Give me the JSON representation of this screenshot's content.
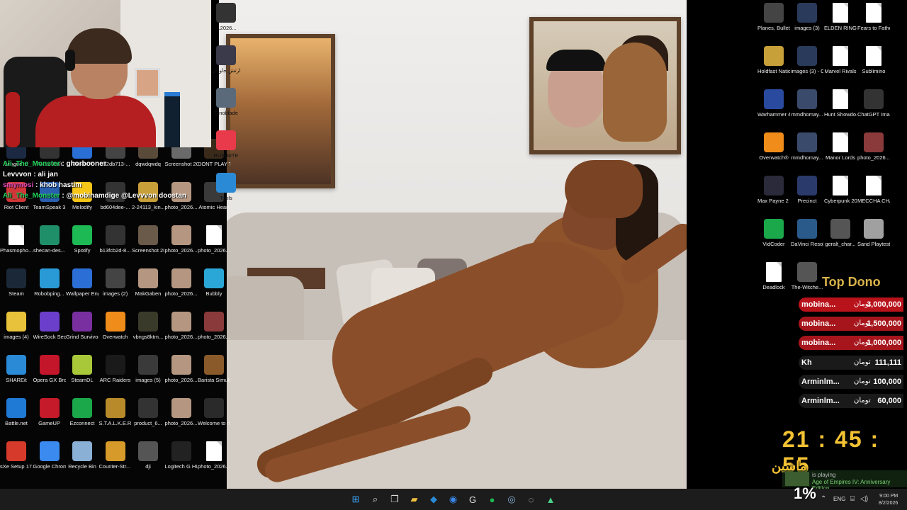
{
  "left_icons": [
    {
      "label": "League of",
      "color": "#1b2a42"
    },
    {
      "label": "PacketRaft",
      "color": "#333333"
    },
    {
      "label": "Microsoft",
      "color": "#2a6fd6"
    },
    {
      "label": "b52db713-...",
      "color": "#444"
    },
    {
      "label": "dqwdqwdq",
      "color": "#5a4a3a"
    },
    {
      "label": "Screenshot 2026-06-...",
      "color": "#6a6a6a"
    },
    {
      "label": "DONT PLAY THIS",
      "color": "#3a2a1a"
    },
    {
      "label": "Riot Client",
      "color": "#d13639"
    },
    {
      "label": "TeamSpeak 3 Client",
      "color": "#2a5fb0"
    },
    {
      "label": "Melodify",
      "color": "#f5c518"
    },
    {
      "label": "bd604dee-...",
      "color": "#333"
    },
    {
      "label": "2-24113_kin...",
      "color": "#c8a03a"
    },
    {
      "label": "photo_2026...",
      "color": "#b59680"
    },
    {
      "label": "Atomic Heart",
      "color": "#3a3a3a"
    },
    {
      "label": "Phasmopho...",
      "color": "#ffffff",
      "doc": true
    },
    {
      "label": "shecan-des...",
      "color": "#1f8f6a"
    },
    {
      "label": "Spotify",
      "color": "#1db954"
    },
    {
      "label": "b13fcb2d-8...",
      "color": "#333"
    },
    {
      "label": "Screenshot 2026-06-...",
      "color": "#6a5a4a"
    },
    {
      "label": "photo_2026...",
      "color": "#b59680"
    },
    {
      "label": "photo_2026...",
      "color": "#ffffff",
      "doc": true
    },
    {
      "label": "Steam",
      "color": "#1b2838"
    },
    {
      "label": "Robobping...",
      "color": "#2a9ad6"
    },
    {
      "label": "Wallpaper Engine",
      "color": "#2b6fd6"
    },
    {
      "label": "images (2)",
      "color": "#444"
    },
    {
      "label": "MakGaben",
      "color": "#b59680"
    },
    {
      "label": "photo_2026...",
      "color": "#b59680"
    },
    {
      "label": "Bubbly",
      "color": "#2aa7d6"
    },
    {
      "label": "images (4)",
      "color": "#e8c23a"
    },
    {
      "label": "WireSock Secure ...",
      "color": "#6b3fc9"
    },
    {
      "label": "Grind Survivors",
      "color": "#7a2fa0"
    },
    {
      "label": "Overwatch",
      "color": "#f08c1a"
    },
    {
      "label": "vbngs8ktm...",
      "color": "#3a3a2a"
    },
    {
      "label": "photo_2026...",
      "color": "#b59680"
    },
    {
      "label": "photo_2026...",
      "color": "#8a3a3a"
    },
    {
      "label": "SHAREit",
      "color": "#2a8ad6"
    },
    {
      "label": "Opera GX Browser",
      "color": "#c4162a"
    },
    {
      "label": "SteamDL",
      "color": "#a8c83a"
    },
    {
      "label": "ARC Raiders",
      "color": "#1a1a1a"
    },
    {
      "label": "images (5)",
      "color": "#3a3a3a"
    },
    {
      "label": "photo_2026...",
      "color": "#b59680"
    },
    {
      "label": "Barista Simulator",
      "color": "#8a5a2a"
    },
    {
      "label": "Battle.net",
      "color": "#1f7ad6"
    },
    {
      "label": "GameUP",
      "color": "#c41a2a"
    },
    {
      "label": "Ezconnect",
      "color": "#1aa84a"
    },
    {
      "label": "S.T.A.L.K.E.R. 2 Heart of ...",
      "color": "#b88a2a"
    },
    {
      "label": "product_6...",
      "color": "#333"
    },
    {
      "label": "photo_2026...",
      "color": "#b59680"
    },
    {
      "label": "Welcome to the Game...",
      "color": "#2a2a2a"
    },
    {
      "label": "sXe Setup 17.2",
      "color": "#d63a2a"
    },
    {
      "label": "Google Chrome",
      "color": "#3a8af0"
    },
    {
      "label": "Recycle Bin",
      "color": "#8ab0d6"
    },
    {
      "label": "Counter-Str... 2",
      "color": "#d69a2a"
    },
    {
      "label": "dji",
      "color": "#555"
    },
    {
      "label": "Logitech G HUB",
      "color": "#222"
    },
    {
      "label": "photo_2026...",
      "color": "#ffffff",
      "doc": true
    }
  ],
  "mid_icons": [
    {
      "label": "...2026...",
      "color": "#333"
    },
    {
      "label": "ارتش جاودان",
      "color": "#3a3a4a"
    },
    {
      "label": "Dinoblade",
      "color": "#5a6a7a"
    },
    {
      "label": "RUBINITE",
      "color": "#e83a4a"
    },
    {
      "label": "Tools",
      "color": "#2a8ad6"
    }
  ],
  "right_icons": [
    {
      "label": "Planes, Bullets an...",
      "color": "#444"
    },
    {
      "label": "images (3)",
      "color": "#2a3a5a"
    },
    {
      "label": "ELDEN RING NIGHTREIGN",
      "color": "#ffffff",
      "doc": true
    },
    {
      "label": "Fears to Fathom - Sc...",
      "color": "#ffffff",
      "doc": true
    },
    {
      "label": "Holdfast Nations ...",
      "color": "#c8a03a"
    },
    {
      "label": "images (3) - Copy",
      "color": "#2a3a5a"
    },
    {
      "label": "Marvel Rivals",
      "color": "#ffffff",
      "doc": true
    },
    {
      "label": "Sublimino",
      "color": "#ffffff",
      "doc": true
    },
    {
      "label": "Warhammer 40,000 Spa...",
      "color": "#2a4aa0"
    },
    {
      "label": "mmdhomay...",
      "color": "#3a4a6a"
    },
    {
      "label": "Hunt Showdo...",
      "color": "#ffffff",
      "doc": true
    },
    {
      "label": "ChatGPT Image Jun ...",
      "color": "#333"
    },
    {
      "label": "Overwatch®",
      "color": "#f08c1a"
    },
    {
      "label": "mmdhomay...",
      "color": "#3a4a6a"
    },
    {
      "label": "Manor Lords",
      "color": "#ffffff",
      "doc": true
    },
    {
      "label": "photo_2026...",
      "color": "#8a3a3a"
    },
    {
      "label": "Max Payne 2 The Fall of ...",
      "color": "#2a2a3a"
    },
    {
      "label": "Precinct",
      "color": "#2a3a6a"
    },
    {
      "label": "Cyberpunk 2077",
      "color": "#ffffff",
      "doc": true
    },
    {
      "label": "MECCHA CHAMELEON",
      "color": "#ffffff",
      "doc": true
    },
    {
      "label": "VidCoder",
      "color": "#1aa84a"
    },
    {
      "label": "DaVinci Resolve",
      "color": "#2a5a8a"
    },
    {
      "label": "geralt_char...",
      "color": "#555"
    },
    {
      "label": "Sand Playtest",
      "color": "#a0a0a0"
    },
    {
      "label": "Deadlock",
      "color": "#ffffff",
      "doc": true
    },
    {
      "label": "The-Witche...",
      "color": "#555"
    }
  ],
  "chat": [
    {
      "user": "Ali_The_Monster",
      "user_color": "green",
      "msg": "ghorbooneт"
    },
    {
      "user": "Levvvon",
      "user_color": "white",
      "msg": "ali jan"
    },
    {
      "user": "smymosi",
      "user_color": "pink",
      "msg": "khob hastim"
    },
    {
      "user": "Ali_The_Monster",
      "user_color": "green",
      "msg": "@mobinamdige @Levvvon doostan"
    }
  ],
  "top_dono": {
    "title": "Top Dono",
    "currency": "تومان",
    "entries": [
      {
        "name": "mobina...",
        "amount": "3,000,000"
      },
      {
        "name": "mobina...",
        "amount": "1,500,000"
      },
      {
        "name": "mobina...",
        "amount": "1,000,000"
      },
      {
        "name": "Kh",
        "amount": "111,111"
      },
      {
        "name": "Arminlm...",
        "amount": "100,000"
      },
      {
        "name": "Arminlm...",
        "amount": "60,000"
      }
    ]
  },
  "clock": {
    "h": "21",
    "m": "45",
    "s": "55"
  },
  "streamer_name": "ماشین",
  "now_playing": {
    "status": "is playing",
    "game": "Age of Empires IV: Anniversary Edition"
  },
  "overlay": {
    "cpu": "1%"
  },
  "taskbar": {
    "items": [
      "start-icon",
      "search-icon",
      "task-view-icon",
      "file-explorer-icon",
      "vscode-icon",
      "chrome-icon",
      "logitech-icon",
      "spotify-icon",
      "steam-icon",
      "obs-icon",
      "app-icon"
    ],
    "lang": "ENG",
    "time": "9:00 PM",
    "date": "8/2/2026"
  }
}
